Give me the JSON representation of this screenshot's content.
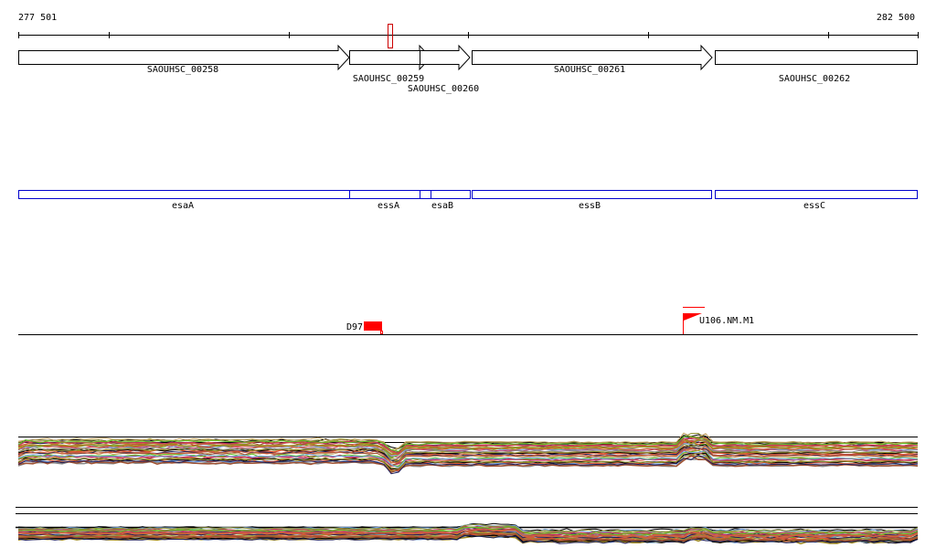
{
  "ruler": {
    "start_label": "277 501",
    "end_label": "282 500"
  },
  "genes": [
    {
      "id": "SAOUHSC_00258"
    },
    {
      "id": "SAOUHSC_00259"
    },
    {
      "id": "SAOUHSC_00260"
    },
    {
      "id": "SAOUHSC_00261"
    },
    {
      "id": "SAOUHSC_00262"
    }
  ],
  "gene_names": [
    "esaA",
    "essA",
    "esaB",
    "essB",
    "essC"
  ],
  "features": [
    {
      "label": "D97",
      "color": "#ff0000"
    },
    {
      "label": "U106.NM.M1",
      "color": "#ff0000"
    }
  ],
  "colors": {
    "accent": "#ff0000",
    "gene_box": "#0000cc"
  }
}
